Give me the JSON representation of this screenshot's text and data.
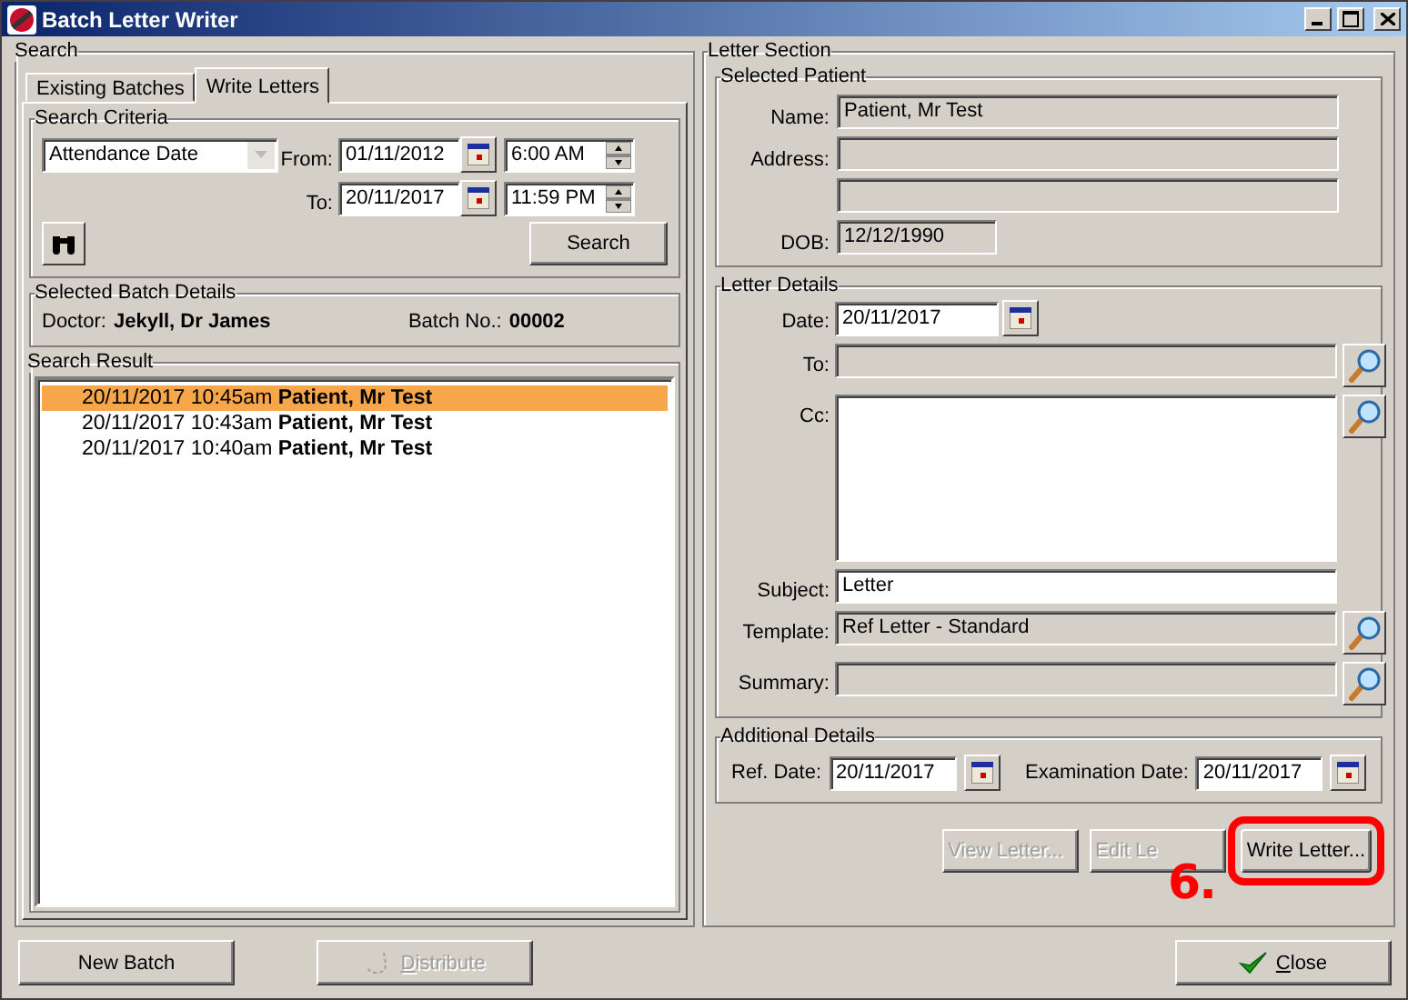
{
  "window": {
    "title": "Batch Letter Writer"
  },
  "search": {
    "title": "Search",
    "tabs": [
      {
        "label": "Existing Batches",
        "selected": false
      },
      {
        "label": "Write Letters",
        "selected": true
      }
    ],
    "criteria": {
      "title": "Search Criteria",
      "date_type": "Attendance Date",
      "from_label": "From:",
      "from_date": "01/11/2012",
      "from_time": "6:00 AM",
      "to_label": "To:",
      "to_date": "20/11/2017",
      "to_time": "11:59 PM",
      "search_button": "Search"
    },
    "batch_details": {
      "title": "Selected Batch Details",
      "doctor_label": "Doctor:",
      "doctor": "Jekyll, Dr James",
      "batch_label": "Batch No.:",
      "batch_no": "00002"
    },
    "results": {
      "title": "Search Result",
      "rows": [
        {
          "text": "20/11/2017 10:45am **Patient, Mr Test**",
          "selected": true
        },
        {
          "text": "20/11/2017 10:43am **Patient, Mr Test**",
          "selected": false
        },
        {
          "text": "20/11/2017 10:40am **Patient, Mr Test**",
          "selected": false
        }
      ]
    }
  },
  "letter_section": {
    "title": "Letter Section",
    "patient": {
      "title": "Selected Patient",
      "name_label": "Name:",
      "name": "Patient, Mr Test",
      "address_label": "Address:",
      "dob_label": "DOB:",
      "dob": "12/12/1990"
    },
    "letter_details": {
      "title": "Letter Details",
      "rows": [
        {
          "kind": "date",
          "label": "Date:",
          "value": "20/11/2017"
        },
        {
          "kind": "lookup",
          "label": "To:"
        },
        {
          "kind": "memo",
          "label": "Cc:"
        },
        {
          "kind": "text",
          "label": "Subject:",
          "value": "Letter"
        },
        {
          "kind": "lookup",
          "label": "Template:",
          "value": "Ref Letter - Standard"
        },
        {
          "kind": "lookup",
          "label": "Summary:"
        }
      ]
    },
    "additional": {
      "title": "Additional Details",
      "ref_label": "Ref. Date:",
      "ref_date": "20/11/2017",
      "exam_label": "Examination Date:",
      "exam_date": "20/11/2017"
    },
    "buttons": [
      {
        "label": "View Letter...",
        "disabled": true,
        "highlighted": false
      },
      {
        "label": "Edit Le",
        "disabled": true,
        "highlighted": false
      },
      {
        "label": "Write Letter...",
        "disabled": false,
        "highlighted": true
      }
    ],
    "annotation": "6."
  },
  "footer": {
    "new_batch": {
      "label": "New Batch",
      "disabled": false
    },
    "distribute": {
      "label": "Distribute",
      "disabled": true
    },
    "close": {
      "label": "Close",
      "disabled": false
    }
  }
}
